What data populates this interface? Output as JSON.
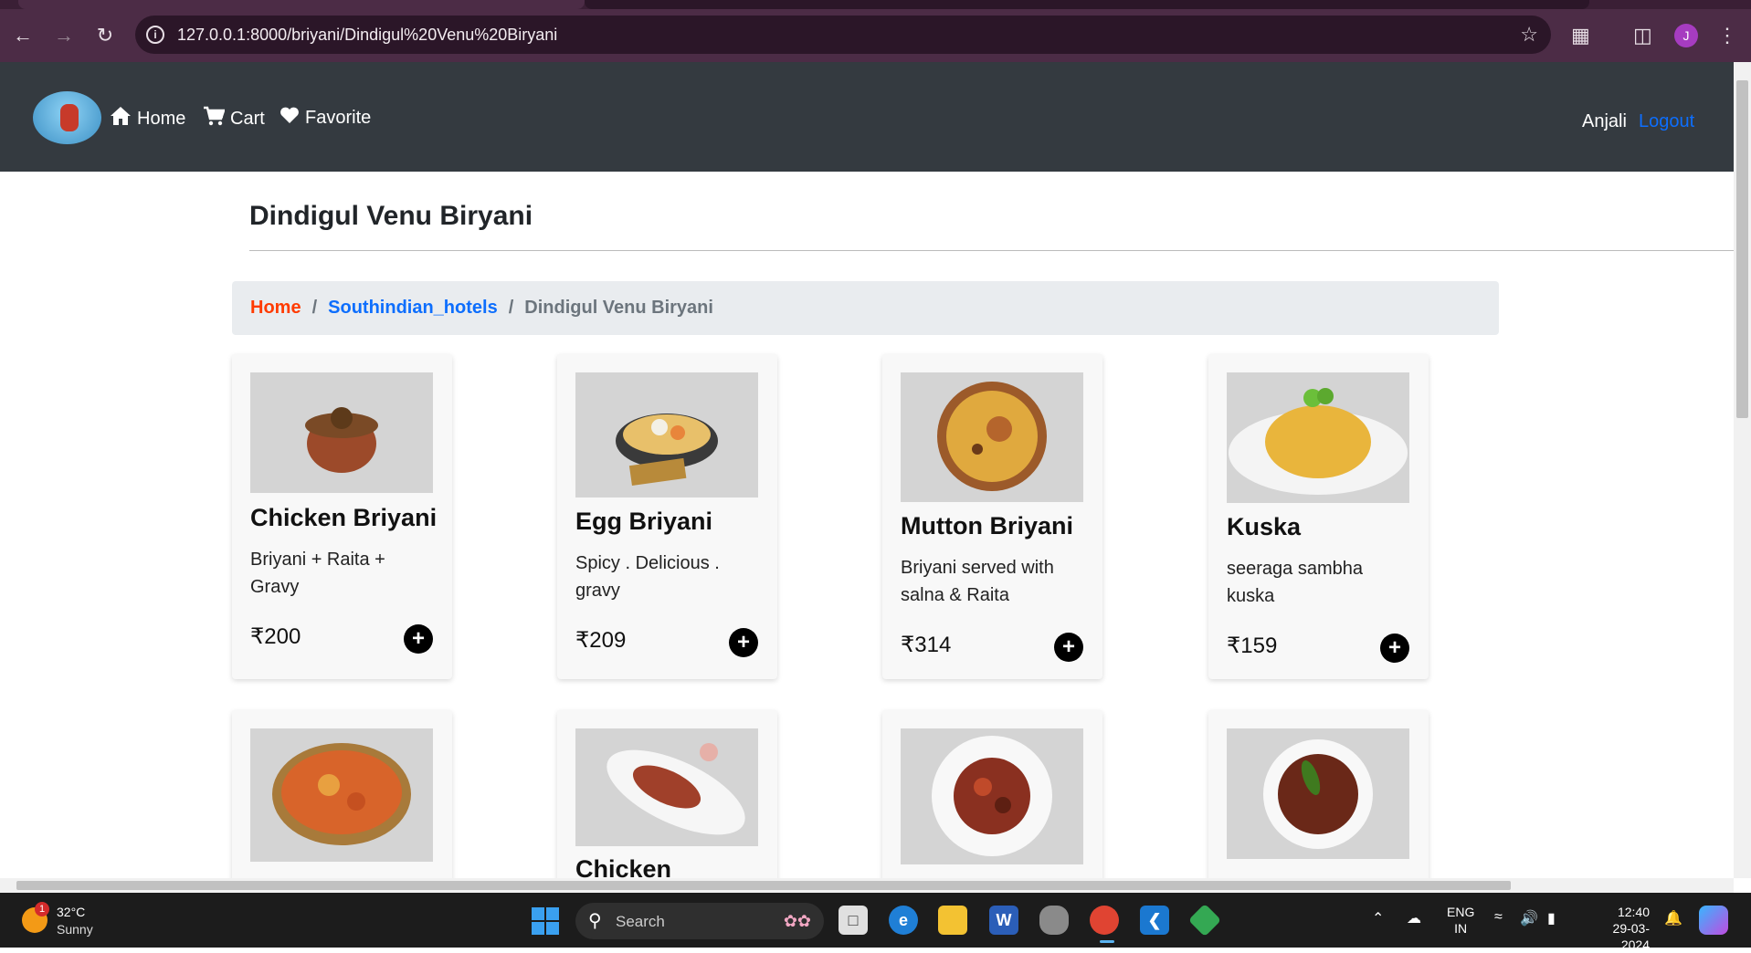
{
  "browser": {
    "url": "127.0.0.1:8000/briyani/Dindigul%20Venu%20Biryani",
    "profile_initial": "J"
  },
  "navbar": {
    "home": "Home",
    "cart": "Cart",
    "favorite": "Favorite",
    "user": "Anjali",
    "logout": "Logout"
  },
  "page": {
    "title": "Dindigul Venu Biryani"
  },
  "breadcrumb": {
    "home": "Home",
    "hotels": "Southindian_hotels",
    "current": "Dindigul Venu Biryani",
    "separator": "/"
  },
  "products": [
    {
      "name": "Chicken Briyani",
      "desc": "Briyani + Raita + Gravy",
      "price": "₹200"
    },
    {
      "name": "Egg Briyani",
      "desc": "Spicy . Delicious . gravy",
      "price": "₹209"
    },
    {
      "name": "Mutton Briyani",
      "desc": "Briyani served with salna & Raita",
      "price": "₹314"
    },
    {
      "name": "Kuska",
      "desc": "seeraga sambha kuska",
      "price": "₹159"
    },
    {
      "name": "",
      "desc": "",
      "price": ""
    },
    {
      "name": "Chicken",
      "desc": "",
      "price": ""
    },
    {
      "name": "",
      "desc": "",
      "price": ""
    },
    {
      "name": "",
      "desc": "",
      "price": ""
    }
  ],
  "add_label": "+",
  "taskbar": {
    "temp": "32°C",
    "condition": "Sunny",
    "weather_badge": "1",
    "search": "Search",
    "lang_top": "ENG",
    "lang_bottom": "IN",
    "time": "12:40",
    "date": "29-03-2024"
  }
}
